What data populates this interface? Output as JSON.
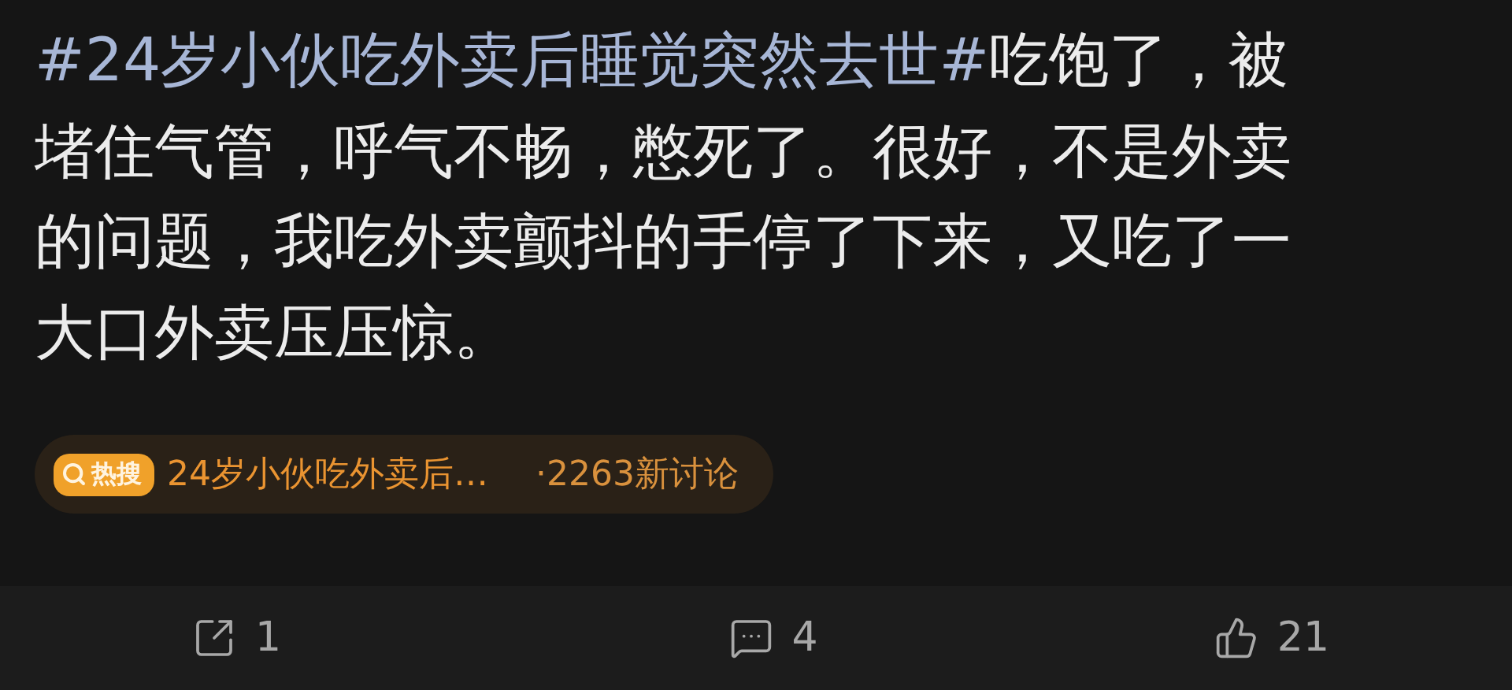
{
  "post": {
    "hashtag": "#24岁小伙吃外卖后睡觉突然去世#",
    "lines": [
      "吃饱了，被",
      "堵住气管，呼气不畅，憋死了。很好，不是外卖",
      "的问题，我吃外卖颤抖的手停了下来，又吃了一",
      "大口外卖压压惊。"
    ]
  },
  "hot_search": {
    "badge": "热搜",
    "topic": "24岁小伙吃外卖后…",
    "discussion": "·2263新讨论"
  },
  "actions": [
    {
      "kind": "share",
      "count": "1"
    },
    {
      "kind": "comment",
      "count": "4"
    },
    {
      "kind": "like",
      "count": "21"
    }
  ]
}
